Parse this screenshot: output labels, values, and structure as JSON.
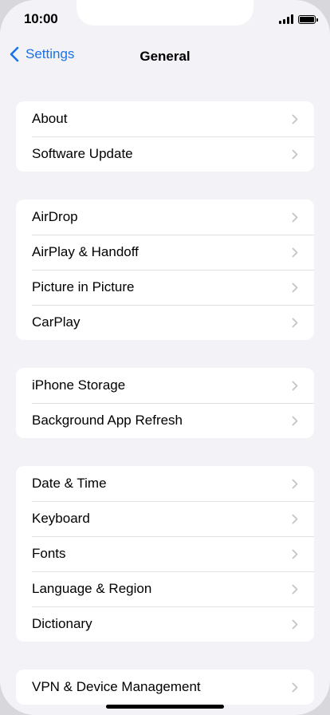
{
  "status_bar": {
    "time": "10:00",
    "icons": [
      "cellular-signal-icon",
      "battery-icon"
    ]
  },
  "nav": {
    "back_label": "Settings",
    "title": "General",
    "accent_color": "#1a73e8"
  },
  "groups": [
    {
      "rows": [
        {
          "label": "About"
        },
        {
          "label": "Software Update"
        }
      ]
    },
    {
      "rows": [
        {
          "label": "AirDrop"
        },
        {
          "label": "AirPlay & Handoff"
        },
        {
          "label": "Picture in Picture"
        },
        {
          "label": "CarPlay"
        }
      ]
    },
    {
      "rows": [
        {
          "label": "iPhone Storage"
        },
        {
          "label": "Background App Refresh"
        }
      ]
    },
    {
      "rows": [
        {
          "label": "Date & Time"
        },
        {
          "label": "Keyboard"
        },
        {
          "label": "Fonts"
        },
        {
          "label": "Language & Region"
        },
        {
          "label": "Dictionary"
        }
      ]
    },
    {
      "rows": [
        {
          "label": "VPN & Device Management"
        }
      ]
    }
  ]
}
